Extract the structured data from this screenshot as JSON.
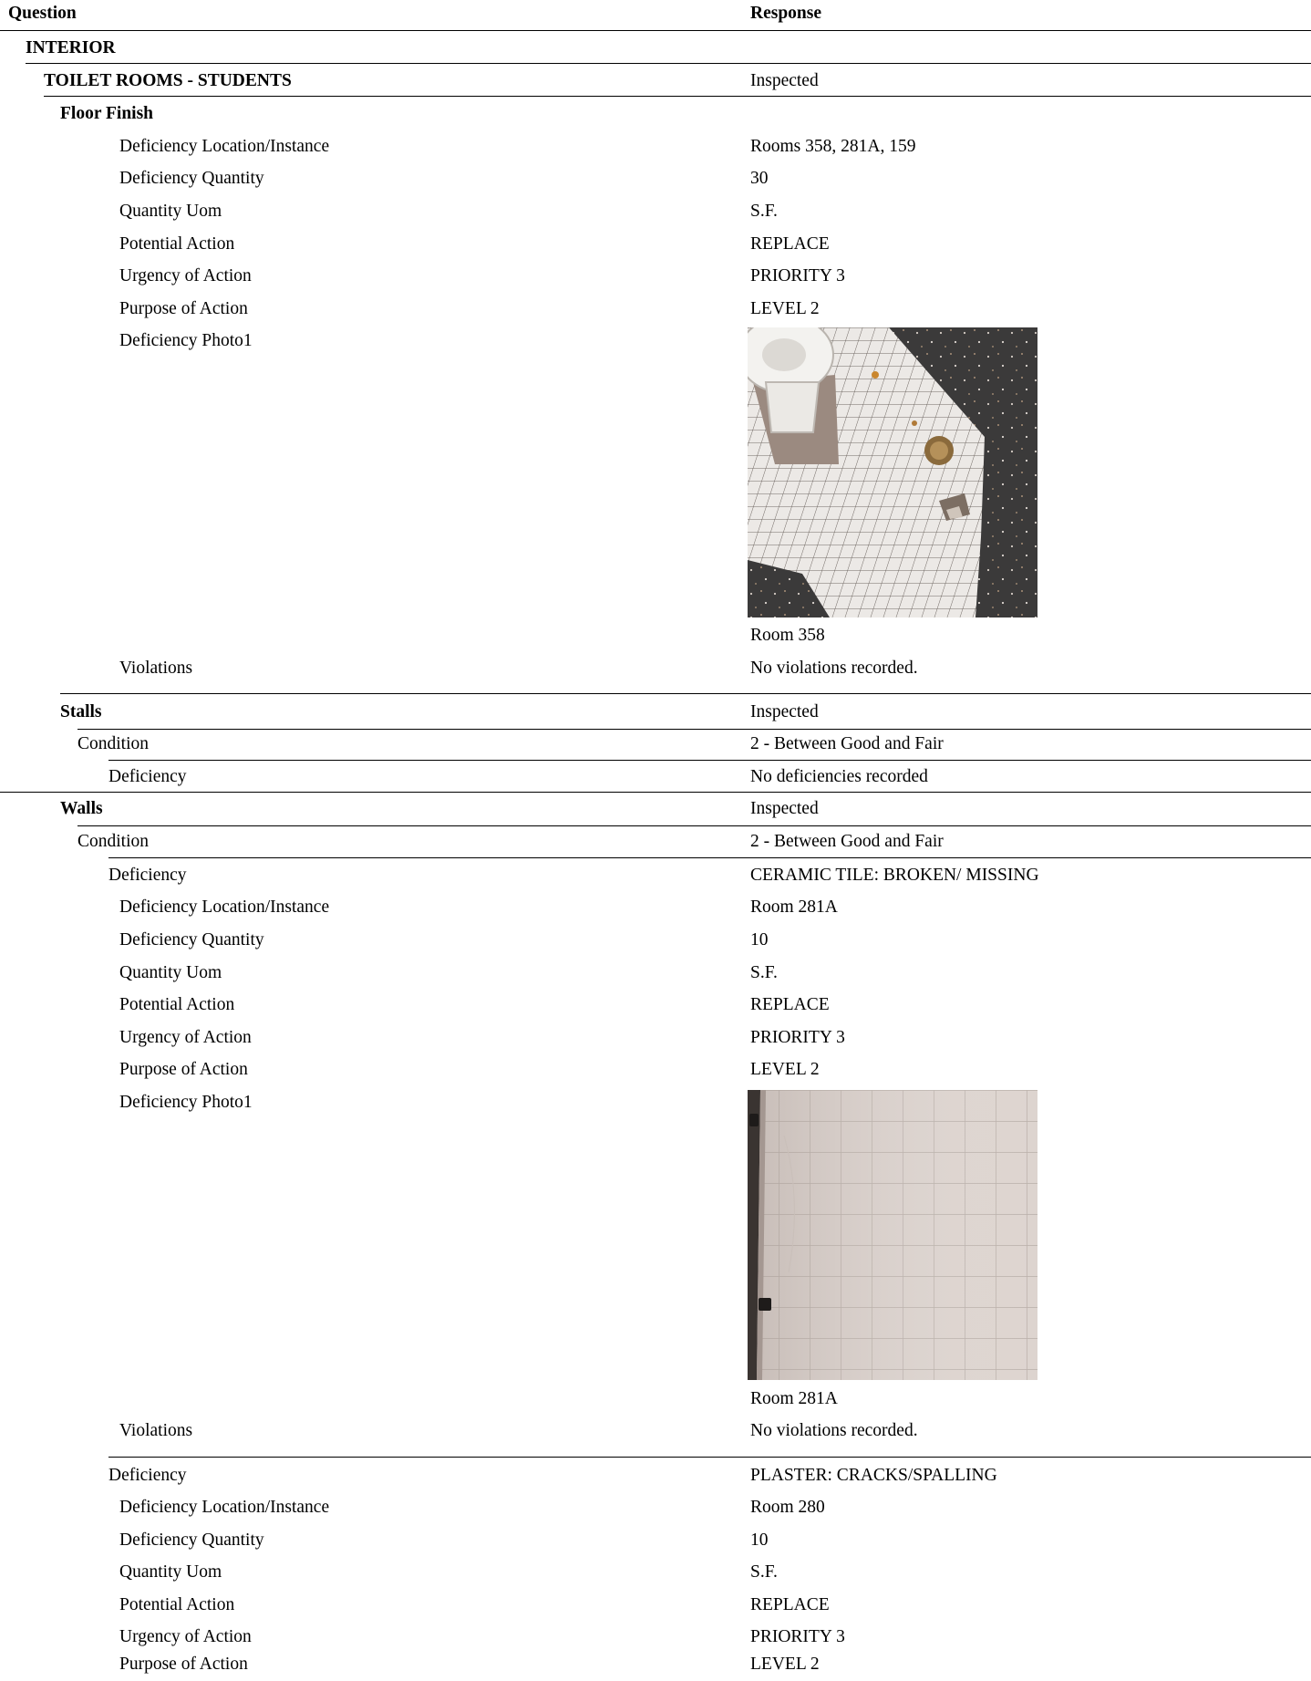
{
  "header": {
    "question": "Question",
    "response": "Response"
  },
  "interior": {
    "label": "INTERIOR"
  },
  "toilet": {
    "label": "TOILET ROOMS - STUDENTS",
    "response": "Inspected"
  },
  "floor": {
    "label": "Floor Finish",
    "fields": [
      {
        "q": "Deficiency Location/Instance",
        "r": "Rooms 358, 281A, 159"
      },
      {
        "q": "Deficiency Quantity",
        "r": "30"
      },
      {
        "q": "Quantity Uom",
        "r": "S.F."
      },
      {
        "q": "Potential Action",
        "r": "REPLACE"
      },
      {
        "q": "Urgency of Action",
        "r": "PRIORITY 3"
      },
      {
        "q": "Purpose of Action",
        "r": "LEVEL 2"
      }
    ],
    "photo_label": "Deficiency Photo1",
    "photo_caption": "Room 358",
    "violations_label": "Violations",
    "violations": "No violations recorded."
  },
  "stalls": {
    "label": "Stalls",
    "response": "Inspected",
    "condition_label": "Condition",
    "condition": "2 - Between Good and Fair",
    "deficiency_label": "Deficiency",
    "deficiency": "No deficiencies recorded"
  },
  "walls": {
    "label": "Walls",
    "response": "Inspected",
    "condition_label": "Condition",
    "condition": "2 - Between Good and Fair",
    "def1": {
      "label": "Deficiency",
      "response": "CERAMIC TILE: BROKEN/ MISSING",
      "fields": [
        {
          "q": "Deficiency Location/Instance",
          "r": "Room 281A"
        },
        {
          "q": "Deficiency Quantity",
          "r": "10"
        },
        {
          "q": "Quantity Uom",
          "r": "S.F."
        },
        {
          "q": "Potential Action",
          "r": "REPLACE"
        },
        {
          "q": "Urgency of Action",
          "r": "PRIORITY 3"
        },
        {
          "q": "Purpose of Action",
          "r": "LEVEL 2"
        }
      ],
      "photo_label": "Deficiency Photo1",
      "photo_caption": "Room 281A",
      "violations_label": "Violations",
      "violations": "No violations recorded."
    },
    "def2": {
      "label": "Deficiency",
      "response": "PLASTER: CRACKS/SPALLING",
      "fields": [
        {
          "q": "Deficiency Location/Instance",
          "r": "Room 280"
        },
        {
          "q": "Deficiency Quantity",
          "r": "10"
        },
        {
          "q": "Quantity Uom",
          "r": "S.F."
        },
        {
          "q": "Potential Action",
          "r": "REPLACE"
        },
        {
          "q": "Urgency of Action",
          "r": "PRIORITY 3"
        },
        {
          "q": "Purpose of Action",
          "r": "LEVEL 2"
        }
      ]
    }
  }
}
